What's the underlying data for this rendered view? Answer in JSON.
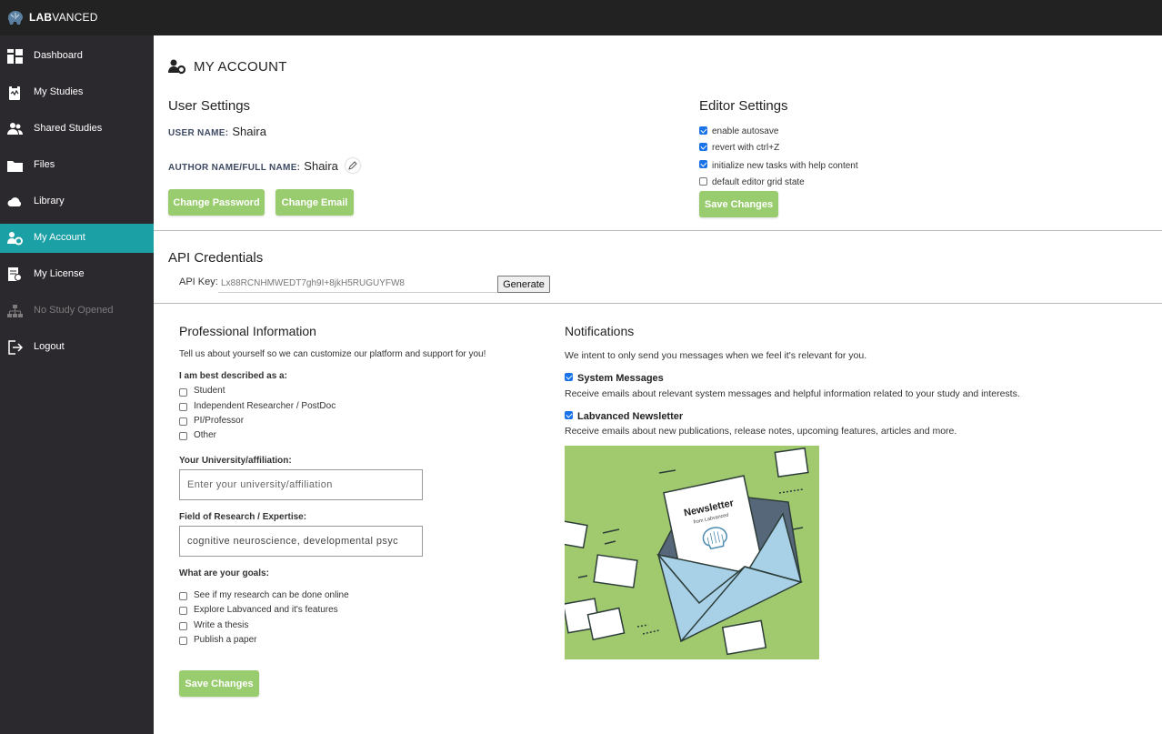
{
  "brand": {
    "name_bold": "LAB",
    "name_rest": "VANCED"
  },
  "sidebar": {
    "items": [
      {
        "label": "Dashboard",
        "icon": "dashboard-icon"
      },
      {
        "label": "My Studies",
        "icon": "clipboard-icon"
      },
      {
        "label": "Shared Studies",
        "icon": "users-icon"
      },
      {
        "label": "Files",
        "icon": "folder-icon"
      },
      {
        "label": "Library",
        "icon": "cloud-icon"
      },
      {
        "label": "My Account",
        "icon": "user-gear-icon",
        "active": true
      },
      {
        "label": "My License",
        "icon": "license-icon"
      },
      {
        "label": "No Study Opened",
        "icon": "sitemap-icon",
        "disabled": true
      },
      {
        "label": "Logout",
        "icon": "logout-icon"
      }
    ]
  },
  "page": {
    "title": "MY ACCOUNT"
  },
  "user_settings": {
    "heading": "User Settings",
    "username_label": "USER NAME:",
    "username_value": "Shaira",
    "author_label": "AUTHOR NAME/FULL NAME:",
    "author_value": "Shaira",
    "change_password": "Change Password",
    "change_email": "Change Email"
  },
  "editor_settings": {
    "heading": "Editor Settings",
    "options": [
      {
        "label": "enable autosave",
        "checked": true
      },
      {
        "label": "revert with ctrl+Z",
        "checked": true
      },
      {
        "label": "initialize new tasks with help content",
        "checked": true
      },
      {
        "label": "default editor grid state",
        "checked": false
      }
    ],
    "save": "Save Changes"
  },
  "api": {
    "heading": "API Credentials",
    "key_label": "API Key:",
    "key_value": "Lx88RCNHMWEDT7gh9I+8jkH5RUGUYFW8",
    "generate": "Generate"
  },
  "professional": {
    "heading": "Professional Information",
    "intro": "Tell us about yourself so we can customize our platform and support for you!",
    "describe_label": "I am best described as a:",
    "roles": [
      "Student",
      "Independent Researcher / PostDoc",
      "PI/Professor",
      "Other"
    ],
    "university_label": "Your University/affiliation:",
    "university_placeholder": "Enter your university/affiliation",
    "field_label": "Field of Research / Expertise:",
    "field_value": "cognitive neuroscience, developmental psyc",
    "goals_label": "What are your goals:",
    "goals": [
      "See if my research can be done online",
      "Explore Labvanced and it's features",
      "Write a thesis",
      "Publish a paper"
    ],
    "save": "Save Changes"
  },
  "notifications": {
    "heading": "Notifications",
    "intro": "We intent to only send you messages when we feel it's relevant for you.",
    "system_label": "System Messages",
    "system_desc": "Receive emails about relevant system messages and helpful information related to your study and interests.",
    "newsletter_label": "Labvanced Newsletter",
    "newsletter_desc": "Receive emails about new publications, release notes, upcoming features, articles and more.",
    "image_title": "Newsletter",
    "image_subtitle": "from Labvanced"
  },
  "colors": {
    "accent": "#1ba0a6",
    "green": "#99cc6e",
    "sidebar": "#2b282e",
    "topbar": "#222222"
  }
}
